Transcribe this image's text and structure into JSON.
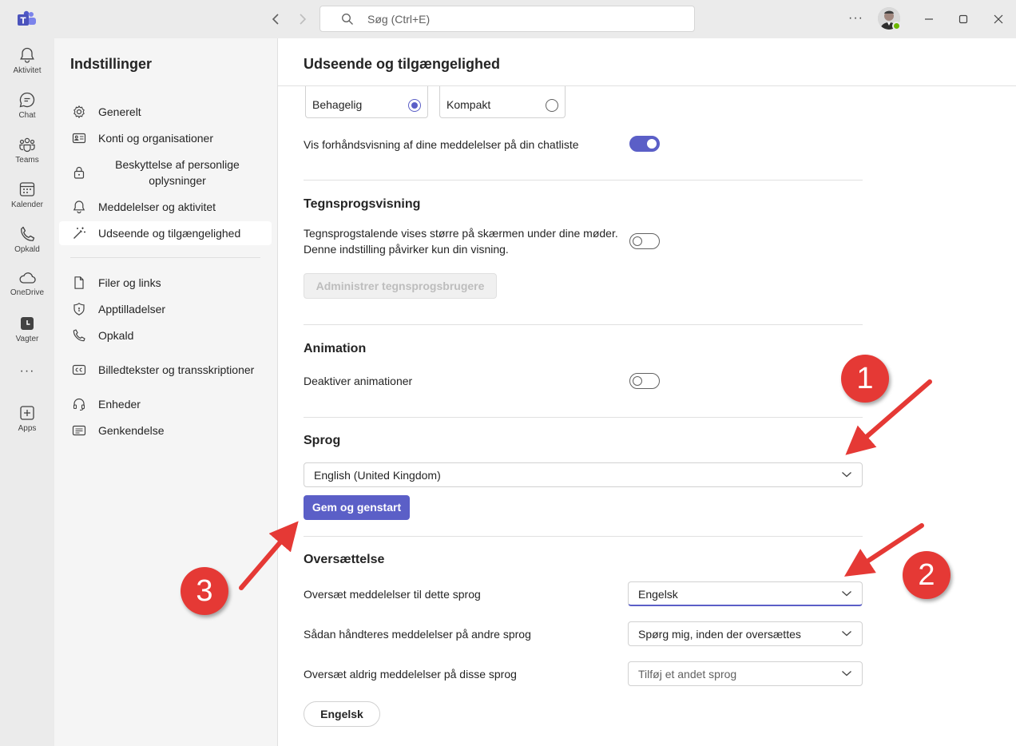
{
  "titlebar": {
    "search_placeholder": "Søg (Ctrl+E)",
    "more_label": "···"
  },
  "rail": {
    "items": [
      {
        "label": "Aktivitet",
        "icon": "bell-icon"
      },
      {
        "label": "Chat",
        "icon": "chat-icon"
      },
      {
        "label": "Teams",
        "icon": "teams-icon"
      },
      {
        "label": "Kalender",
        "icon": "calendar-icon"
      },
      {
        "label": "Opkald",
        "icon": "phone-icon"
      },
      {
        "label": "OneDrive",
        "icon": "cloud-icon"
      },
      {
        "label": "Vagter",
        "icon": "clock-icon"
      },
      {
        "label": "Apps",
        "icon": "add-apps-icon"
      }
    ],
    "more_label": "···"
  },
  "sidebar": {
    "title": "Indstillinger",
    "items": [
      {
        "label": "Generelt",
        "icon": "gear-icon"
      },
      {
        "label": "Konti og organisationer",
        "icon": "id-card-icon"
      },
      {
        "label": "Beskyttelse af personlige oplysninger",
        "icon": "lock-icon"
      },
      {
        "label": "Meddelelser og aktivitet",
        "icon": "bell-icon"
      },
      {
        "label": "Udseende og tilgængelighed",
        "icon": "magic-wand-icon"
      },
      {
        "label": "Filer og links",
        "icon": "file-icon"
      },
      {
        "label": "Apptilladelser",
        "icon": "shield-icon"
      },
      {
        "label": "Opkald",
        "icon": "phone-icon"
      },
      {
        "label": "Billedtekster og transskriptioner",
        "icon": "cc-icon"
      },
      {
        "label": "Enheder",
        "icon": "headset-icon"
      },
      {
        "label": "Genkendelse",
        "icon": "recognition-icon"
      }
    ]
  },
  "main": {
    "title": "Udseende og tilgængelighed",
    "density": {
      "options": [
        {
          "label": "Behagelig",
          "selected": true
        },
        {
          "label": "Kompakt",
          "selected": false
        }
      ]
    },
    "preview_toggle": {
      "label": "Vis forhåndsvisning af dine meddelelser på din chatliste",
      "on": true
    },
    "sign_language": {
      "title": "Tegnsprogsvisning",
      "line1": "Tegnsprogstalende vises større på skærmen under dine møder.",
      "line2": "Denne indstilling påvirker kun din visning.",
      "on": false,
      "manage_button": "Administrer tegnsprogsbrugere"
    },
    "animation": {
      "title": "Animation",
      "label": "Deaktiver animationer",
      "on": false
    },
    "language": {
      "title": "Sprog",
      "selected": "English (United Kingdom)",
      "save_button": "Gem og genstart"
    },
    "translation": {
      "title": "Oversættelse",
      "rows": [
        {
          "label": "Oversæt meddelelser til dette sprog",
          "value": "Engelsk"
        },
        {
          "label": "Sådan håndteres meddelelser på andre sprog",
          "value": "Spørg mig, inden der oversættes"
        },
        {
          "label": "Oversæt aldrig meddelelser på disse sprog",
          "placeholder": "Tilføj et andet sprog"
        }
      ],
      "chip": "Engelsk"
    }
  },
  "annotations": {
    "badge1": "1",
    "badge2": "2",
    "badge3": "3",
    "color": "#e53935"
  },
  "colors": {
    "accent": "#5b5fc7",
    "rail_bg": "#ebebeb",
    "sidebar_bg": "#f5f5f5"
  }
}
